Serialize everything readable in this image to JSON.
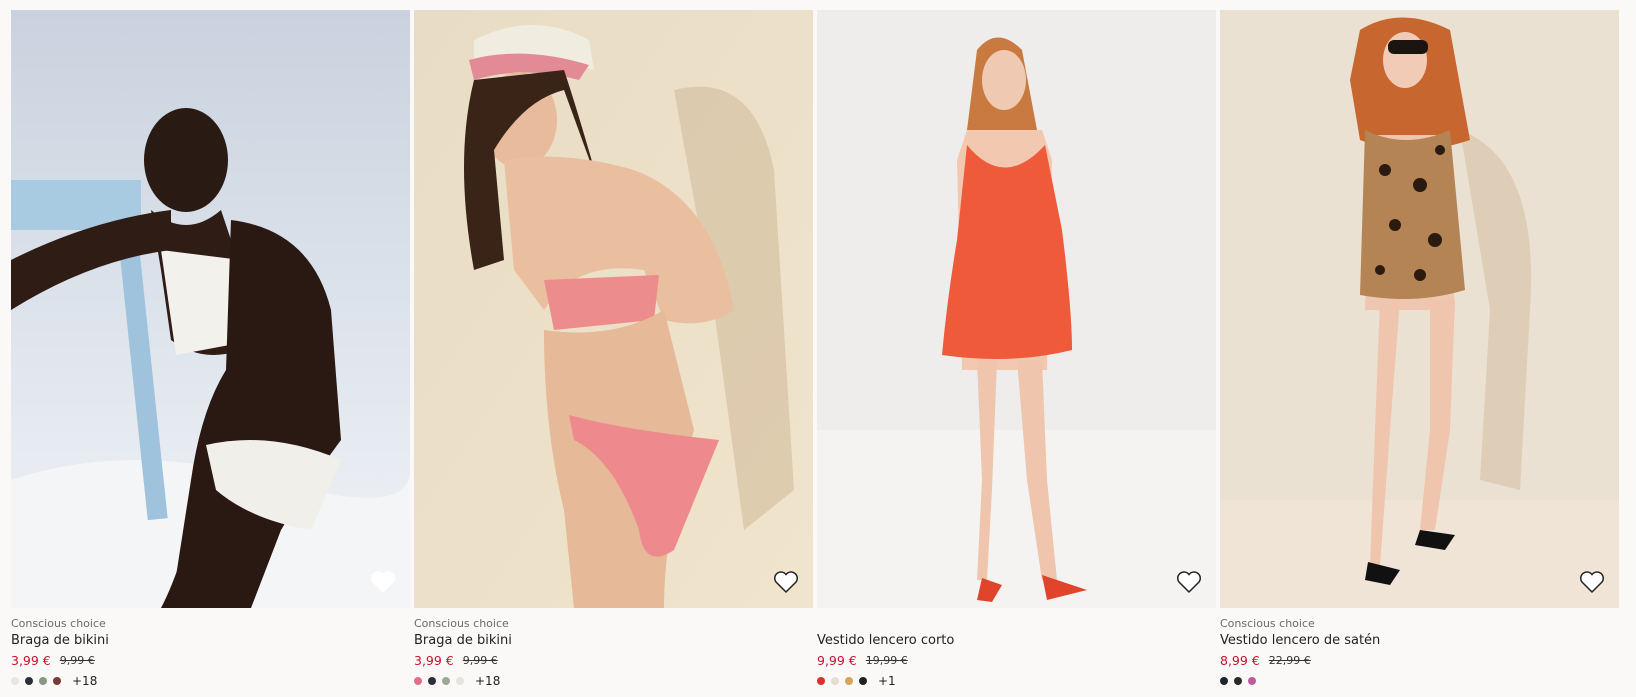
{
  "products": [
    {
      "badge": "Conscious choice",
      "name": "Braga de bikini",
      "price": "3,99 €",
      "old_price": "9,99 €",
      "swatches": [
        "#e8e6e2",
        "#2a2f3a",
        "#8a9a82",
        "#7a3b36"
      ],
      "more": "+18",
      "favorite_icon": "heart-outline-icon"
    },
    {
      "badge": "Conscious choice",
      "name": "Braga de bikini",
      "price": "3,99 €",
      "old_price": "9,99 €",
      "swatches": [
        "#e0708a",
        "#2a2f3a",
        "#9aab92",
        "#e6e4e0"
      ],
      "more": "+18",
      "favorite_icon": "heart-outline-icon"
    },
    {
      "badge": "",
      "name": "Vestido lencero corto",
      "price": "9,99 €",
      "old_price": "19,99 €",
      "swatches": [
        "#d8322a",
        "#e7ddd2",
        "#d6a558",
        "#222222"
      ],
      "more": "+1",
      "favorite_icon": "heart-outline-icon"
    },
    {
      "badge": "Conscious choice",
      "name": "Vestido lencero de satén",
      "price": "8,99 €",
      "old_price": "22,99 €",
      "swatches": [
        "#1f2230",
        "#2a2a2a",
        "#c05a9a"
      ],
      "more": "",
      "favorite_icon": "heart-outline-icon"
    }
  ],
  "colors": {
    "sale_price": "#c8102e"
  }
}
